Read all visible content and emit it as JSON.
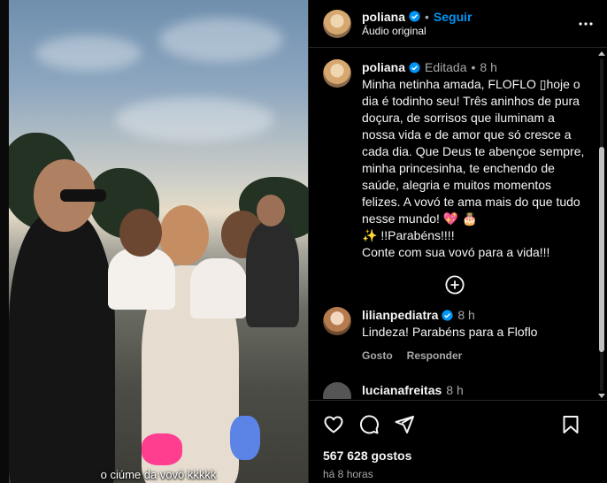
{
  "media": {
    "caption_overlay": "o ciúme da vovó kkkkk"
  },
  "header": {
    "username": "poliana",
    "separator": "•",
    "follow_label": "Seguir",
    "audio_label": "Áudio original"
  },
  "post_caption": {
    "username": "poliana",
    "edited_label": "Editada",
    "separator": "•",
    "time": "8 h",
    "text": "Minha netinha amada, FLOFLO ▯hoje o dia é todinho seu! Três aninhos de pura doçura, de sorrisos que iluminam a nossa vida e de amor que só cresce a cada dia. Que Deus te abençoe sempre, minha princesinha, te enchendo de saúde, alegria e muitos momentos felizes. A vovó te ama mais do que tudo nesse mundo! 💖 🎂",
    "line2": "✨ !!Parabéns!!!!",
    "line3": "Conte com sua vovó para a vida!!!"
  },
  "comments": [
    {
      "username": "lilianpediatra",
      "time": "8 h",
      "text": "Lindeza! Parabéns para a Floflo",
      "like_label": "Gosto",
      "reply_label": "Responder"
    }
  ],
  "partial_comment": {
    "username": "lucianafreitas",
    "time": "8 h"
  },
  "footer": {
    "likes": "567 628 gostos",
    "time_ago": "há 8 horas"
  },
  "colors": {
    "accent": "#0095f6",
    "verified": "#0095f6",
    "muted": "#a8a8a8",
    "divider": "#262626"
  },
  "icons": {
    "more": "more-horizontal-icon",
    "add_comments": "plus-circle-icon",
    "like": "heart-icon",
    "comment": "comment-icon",
    "share": "send-icon",
    "save": "bookmark-icon"
  }
}
